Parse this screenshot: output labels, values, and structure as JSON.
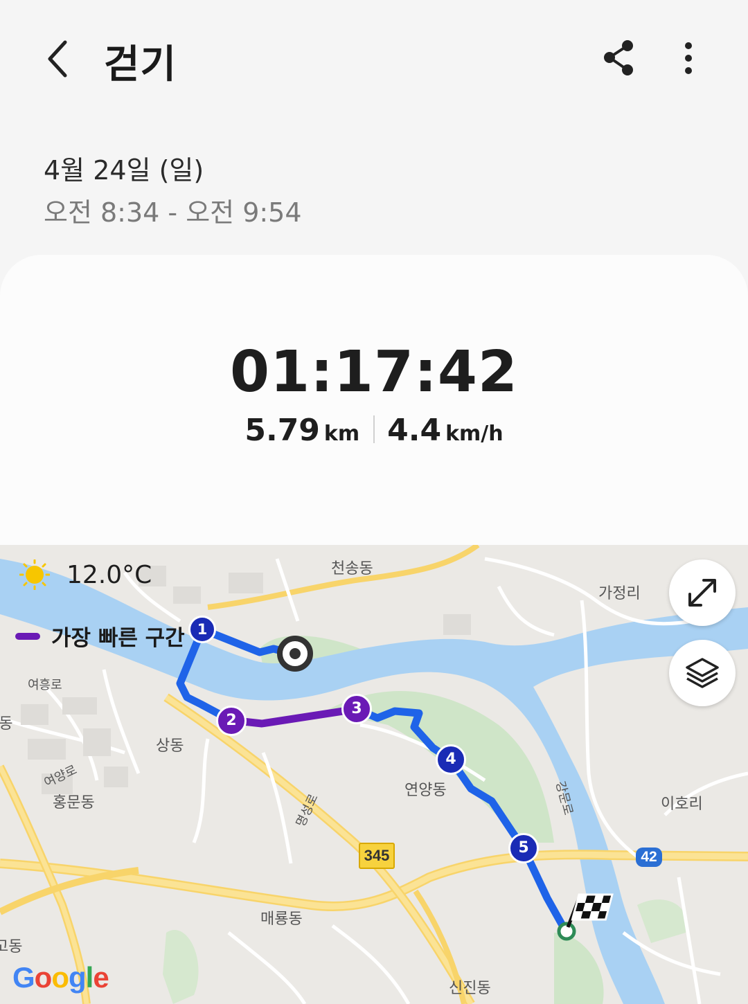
{
  "header": {
    "title": "걷기",
    "back_icon": "chevron-left-icon",
    "share_icon": "share-icon",
    "more_icon": "more-vertical-icon"
  },
  "session": {
    "date": "4월 24일 (일)",
    "time_range": "오전 8:34 - 오전 9:54"
  },
  "summary": {
    "duration": "01:17:42",
    "distance_value": "5.79",
    "distance_unit": "km",
    "speed_value": "4.4",
    "speed_unit": "km/h"
  },
  "map": {
    "weather": {
      "icon": "sun-icon",
      "temperature": "12.0°C"
    },
    "legend": {
      "label": "가장 빠른 구간",
      "color": "#6a1ab5"
    },
    "route_color": "#1f63e8",
    "fastest_color": "#6a1ab5",
    "markers": [
      "1",
      "2",
      "3",
      "4",
      "5"
    ],
    "places": {
      "cheonsong": "천송동",
      "gajeong": "가정리",
      "yeoheung": "여흥로",
      "sang_left": "상동",
      "sangdong": "상동",
      "yeoyang": "여양로",
      "hongmun": "홍문동",
      "myeongseong": "명성로",
      "yeonyang": "연양동",
      "gangmun": "강문로",
      "iho": "이호리",
      "maeryong": "매룡동",
      "go": "고동",
      "sinjin": "신진동"
    },
    "road_shields": {
      "r345": "345",
      "r42": "42"
    },
    "expand_icon": "expand-arrows-icon",
    "layers_icon": "layers-icon",
    "attribution": [
      "G",
      "o",
      "o",
      "g",
      "l",
      "e"
    ]
  }
}
